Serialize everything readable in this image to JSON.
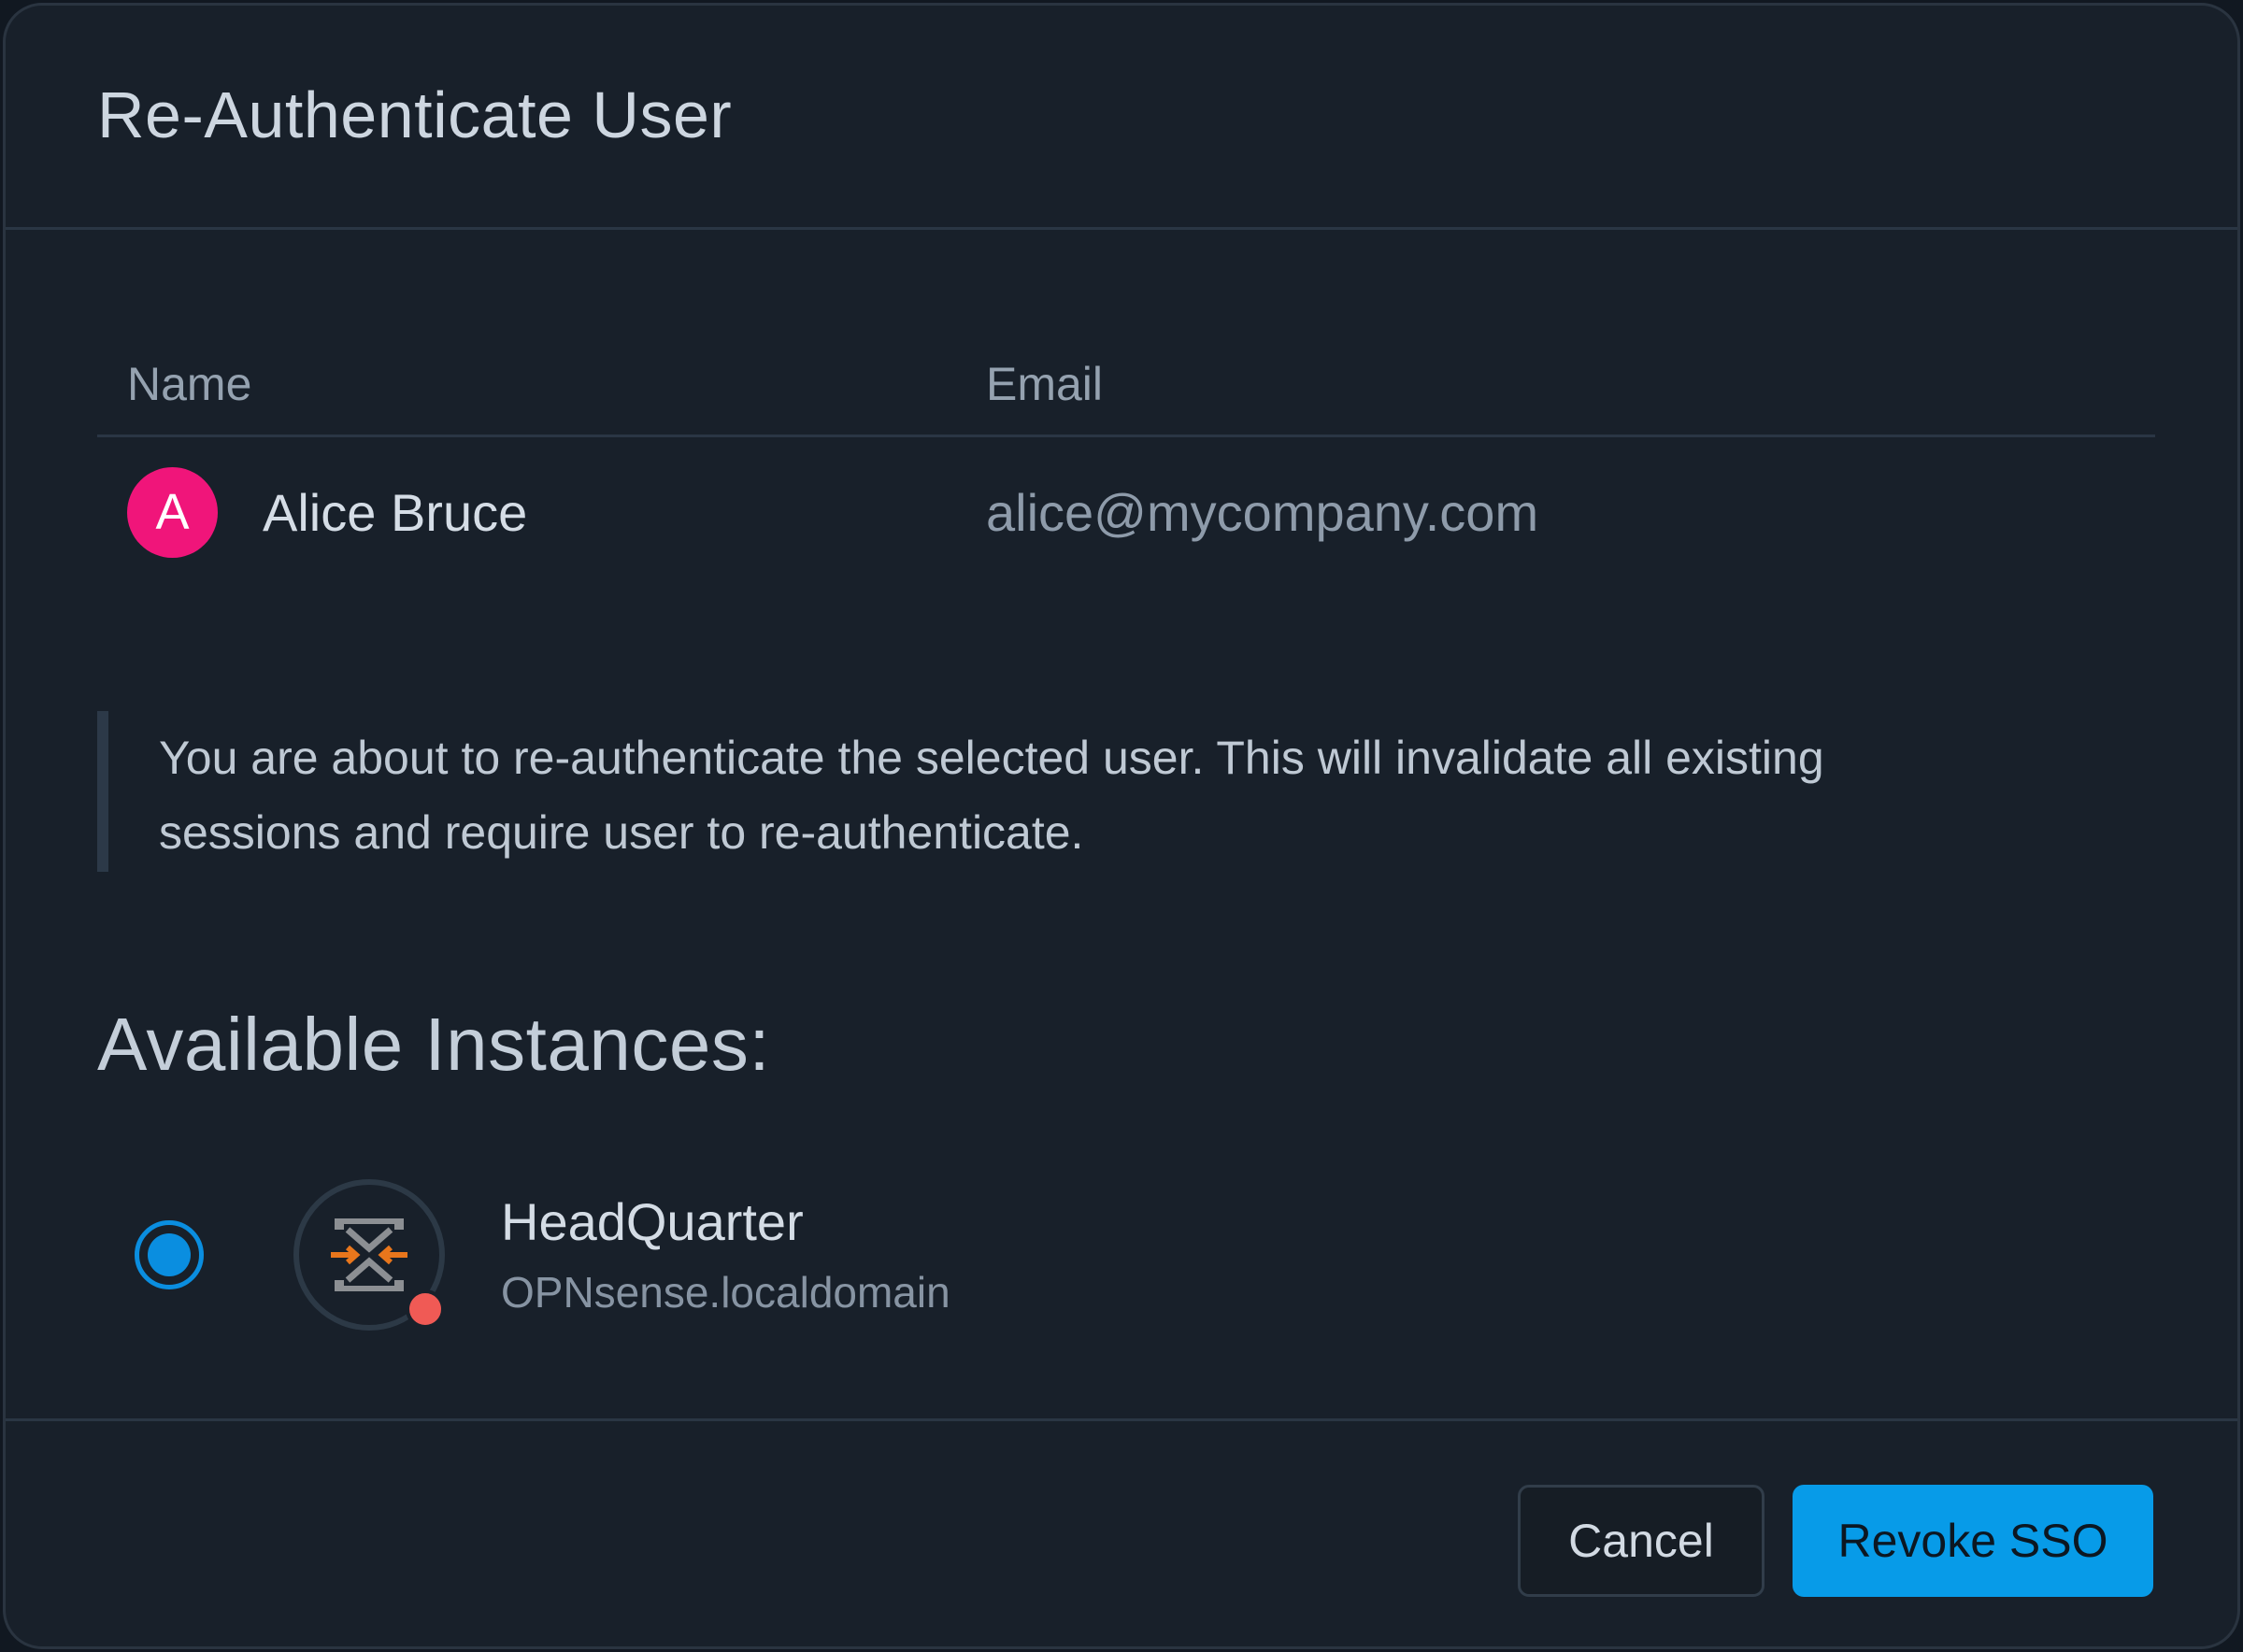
{
  "dialog": {
    "title": "Re-Authenticate User"
  },
  "table": {
    "headers": {
      "name": "Name",
      "email": "Email"
    },
    "rows": [
      {
        "avatar_initial": "A",
        "avatar_color": "#f0157a",
        "name": "Alice Bruce",
        "email": "alice@mycompany.com"
      }
    ]
  },
  "notice": {
    "line1": "You are about to re-authenticate the selected user. This will invalidate all existing",
    "line2": "sessions and require user to re-authenticate."
  },
  "instances": {
    "title": "Available Instances:",
    "items": [
      {
        "name": "HeadQuarter",
        "host": "OPNsense.localdomain",
        "selected": true,
        "status_color": "#f05a55",
        "icon": "opnsense-logo-icon"
      }
    ]
  },
  "footer": {
    "cancel_label": "Cancel",
    "primary_label": "Revoke SSO",
    "primary_color": "#079be8"
  }
}
